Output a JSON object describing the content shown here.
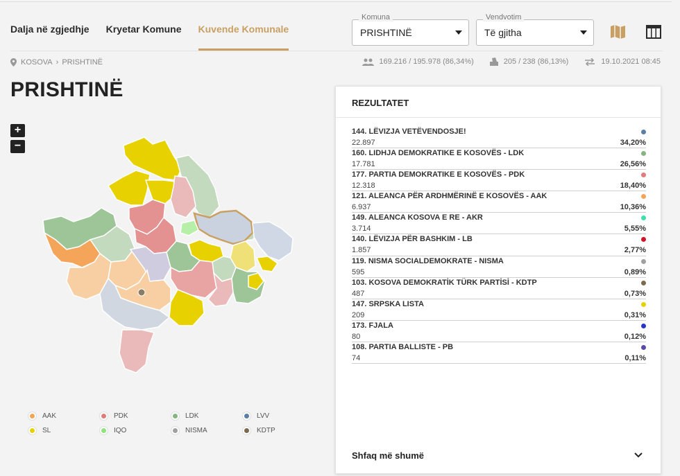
{
  "tabs": [
    {
      "label": "Dalja në zgjedhje",
      "active": false
    },
    {
      "label": "Kryetar Komune",
      "active": false
    },
    {
      "label": "Kuvende Komunale",
      "active": true
    }
  ],
  "filters": {
    "komuna": {
      "label": "Komuna",
      "value": "PRISHTINË"
    },
    "vendvotim": {
      "label": "Vendvotim",
      "value": "Të gjitha"
    }
  },
  "breadcrumb": [
    "KOSOVA",
    "PRISHTINË"
  ],
  "stats": {
    "turnout": "169.216 / 195.978 (86,34%)",
    "stations": "205 / 238 (86,13%)",
    "updated": "19.10.2021 08:45"
  },
  "page_title": "PRISHTINË",
  "zoom": {
    "in": "+",
    "out": "−"
  },
  "results": {
    "title": "REZULTATET",
    "rows": [
      {
        "name": "144. LËVIZJA VETËVENDOSJE!",
        "votes": "22.897",
        "pct": "34,20%",
        "color": "#5b7fa3"
      },
      {
        "name": "160. LIDHJA DEMOKRATIKE E KOSOVËS - LDK",
        "votes": "17.781",
        "pct": "26,56%",
        "color": "#86b582"
      },
      {
        "name": "177. PARTIA DEMOKRATIKE E KOSOVËS - PDK",
        "votes": "12.318",
        "pct": "18,40%",
        "color": "#e07c7c"
      },
      {
        "name": "121. ALEANCA PËR ARDHMËRINË E KOSOVËS - AAK",
        "votes": "6.937",
        "pct": "10,36%",
        "color": "#f5a55a"
      },
      {
        "name": "149. ALEANCA KOSOVA E RE - AKR",
        "votes": "3.714",
        "pct": "5,55%",
        "color": "#3de0a8"
      },
      {
        "name": "140. LËVIZJA PËR BASHKIM - LB",
        "votes": "1.857",
        "pct": "2,77%",
        "color": "#d1132a"
      },
      {
        "name": "119. NISMA SOCIALDEMOKRATE - NISMA",
        "votes": "595",
        "pct": "0,89%",
        "color": "#a0a0a0"
      },
      {
        "name": "103. KOSOVA DEMOKRATİK TÜRK PARTİSİ - KDTP",
        "votes": "487",
        "pct": "0,73%",
        "color": "#7c6a4e"
      },
      {
        "name": "147. SRPSKA LISTA",
        "votes": "209",
        "pct": "0,31%",
        "color": "#e8d100"
      },
      {
        "name": "173. FJALA",
        "votes": "80",
        "pct": "0,12%",
        "color": "#2a35c7"
      },
      {
        "name": "108. PARTIA BALLISTE - PB",
        "votes": "74",
        "pct": "0,11%",
        "color": "#5b4aa8"
      }
    ],
    "more_label": "Shfaq më shumë"
  },
  "legend": [
    {
      "label": "AAK",
      "color": "#f5a55a"
    },
    {
      "label": "PDK",
      "color": "#e07c7c"
    },
    {
      "label": "LDK",
      "color": "#86b582"
    },
    {
      "label": "LVV",
      "color": "#5b7fa3"
    },
    {
      "label": "SL",
      "color": "#e8d100"
    },
    {
      "label": "IQO",
      "color": "#8fe37d"
    },
    {
      "label": "NISMA",
      "color": "#a0a0a0"
    },
    {
      "label": "KDTP",
      "color": "#7c6a4e"
    }
  ],
  "colors": {
    "accent": "#c9a063"
  }
}
